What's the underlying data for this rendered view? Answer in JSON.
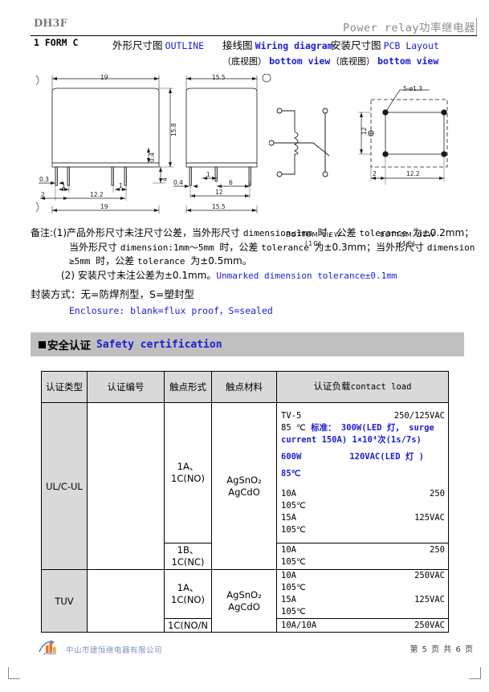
{
  "header": {
    "model": "DH3F",
    "title_right": "Power relay功率继电器",
    "form": "1 FORM C",
    "outline_cn": "外形尺寸图",
    "outline_en": "OUTLINE",
    "wiring_cn": "接线图",
    "wiring_en": "Wiring diagram",
    "pcb_cn": "安装尺寸图",
    "pcb_en": "PCB Layout",
    "bottom_cn": "（底视图）",
    "bottom_en": "bottom view"
  },
  "drawing": {
    "front_view": {
      "top_width": "19",
      "height": "15.8",
      "sub_height": "0.4",
      "pin_height": "4",
      "pin_thick": "0.3",
      "edge": "2",
      "pitch_a": "1",
      "pitch_b": "1",
      "span": "12.2",
      "bottom_width": "19"
    },
    "side_view": {
      "top_width": "15.5",
      "pin_thick": "0.4",
      "pitch": "1",
      "gap": "6",
      "span": "12",
      "bottom_width": "15.5"
    },
    "wiring_caption_1": "BOTTOM VIEW",
    "wiring_caption_2": "(1C)",
    "pcb_caption_1": "BOTTOM VIEW",
    "pcb_caption_2": "(1C)",
    "pcb": {
      "hole_label": "5-ø1.3",
      "height": "12",
      "edge": "2",
      "span": "12.2"
    }
  },
  "notes": {
    "label": "备注:",
    "item1_num": "(1)",
    "item1_l1_a": "产品外形尺寸未注尺寸公差，当外形尺寸 ",
    "item1_l1_b": "dimension≤1mm ",
    "item1_l1_c": "时，公差 ",
    "item1_l1_d": "tolerance ",
    "item1_l1_e": "为±0.2mm；",
    "item1_l2_a": "当外形尺寸 ",
    "item1_l2_b": "dimension:1mm～5mm ",
    "item1_l2_c": "时，公差 ",
    "item1_l2_d": "tolerance ",
    "item1_l2_e": "为±0.3mm；当外形尺寸 ",
    "item1_l2_f": "dimension",
    "item1_l3_a": "≥5mm ",
    "item1_l3_b": "时，公差 ",
    "item1_l3_c": "tolerance ",
    "item1_l3_d": "为±0.5mm。",
    "item2_num": "(2)",
    "item2_cn": "安装尺寸未注公差为±0.1mm。",
    "item2_en": "Unmarked dimension tolerance±0.1mm",
    "enclosure_cn": "封装方式：无=防焊剂型，S=塑封型",
    "enclosure_en": "Enclosure: blank=flux proof，S=sealed"
  },
  "safety": {
    "title_cn": "安全认证",
    "title_en": "Safety certification"
  },
  "table": {
    "headers": [
      {
        "cn": "认证类型",
        "en": ""
      },
      {
        "cn": "认证编号",
        "en": ""
      },
      {
        "cn": "触点形式",
        "en": ""
      },
      {
        "cn": "触点材料",
        "en": ""
      },
      {
        "cn": "认证负载",
        "en": "contact load"
      }
    ],
    "rows": [
      {
        "type": "UL/C-UL",
        "cert_no": "",
        "contact_form": "1A、\n1C(NO)",
        "contact_form_l1": "1A、",
        "contact_form_l2": "1C(NO)",
        "material_l1": "AgSnO₂",
        "material_l2": "AgCdO",
        "loads": [
          {
            "left": "TV-5",
            "right": "250/125VAC",
            "style": "plain"
          },
          {
            "text_prefix": "85 ℃",
            "text_blue_cn": "标准：",
            "text_blue": "300W(LED 灯， surge",
            "style": "mixed"
          },
          {
            "text_blue": "current 150A)  1×10⁴次(1s/7s)",
            "style": "blue"
          },
          {
            "left": "600W",
            "right_blue": "120VAC(LED  灯 )",
            "style": "blue2"
          },
          {
            "text_blue": "85℃",
            "style": "blue"
          },
          {
            "left": "10A",
            "right": "250",
            "style": "plain"
          },
          {
            "left": "105℃",
            "right": "",
            "style": "plain"
          },
          {
            "left": "15A",
            "right": "125VAC",
            "style": "plain"
          },
          {
            "left": "105℃",
            "right": "",
            "style": "plain"
          }
        ]
      },
      {
        "type": "",
        "cert_no": "",
        "contact_form_l1": "1B、",
        "contact_form_l2": "1C(NC)",
        "loads": [
          {
            "left": "10A",
            "right": "250",
            "style": "plain"
          },
          {
            "left": "105℃",
            "right": "",
            "style": "plain"
          }
        ]
      },
      {
        "type": "TUV",
        "cert_no": "",
        "contact_form_l1": "1A、",
        "contact_form_l2": "1C(NO)",
        "material_l1": "AgSnO₂",
        "material_l2": "AgCdO",
        "loads": [
          {
            "left": "10A",
            "right": "250VAC",
            "style": "plain"
          },
          {
            "left": "105℃",
            "right": "",
            "style": "plain"
          },
          {
            "left": "15A",
            "right": "125VAC",
            "style": "plain"
          },
          {
            "left": "105℃",
            "right": "",
            "style": "plain"
          }
        ]
      },
      {
        "type": "",
        "cert_no": "",
        "contact_form_l1": "1C(NO/N",
        "contact_form_l2": "",
        "loads": [
          {
            "left": "10A/10A",
            "right": "250VAC",
            "style": "plain"
          }
        ]
      }
    ]
  },
  "footer": {
    "company": "中山市建恒继电器有限公司",
    "page": "第 5 页 共 6 页"
  }
}
